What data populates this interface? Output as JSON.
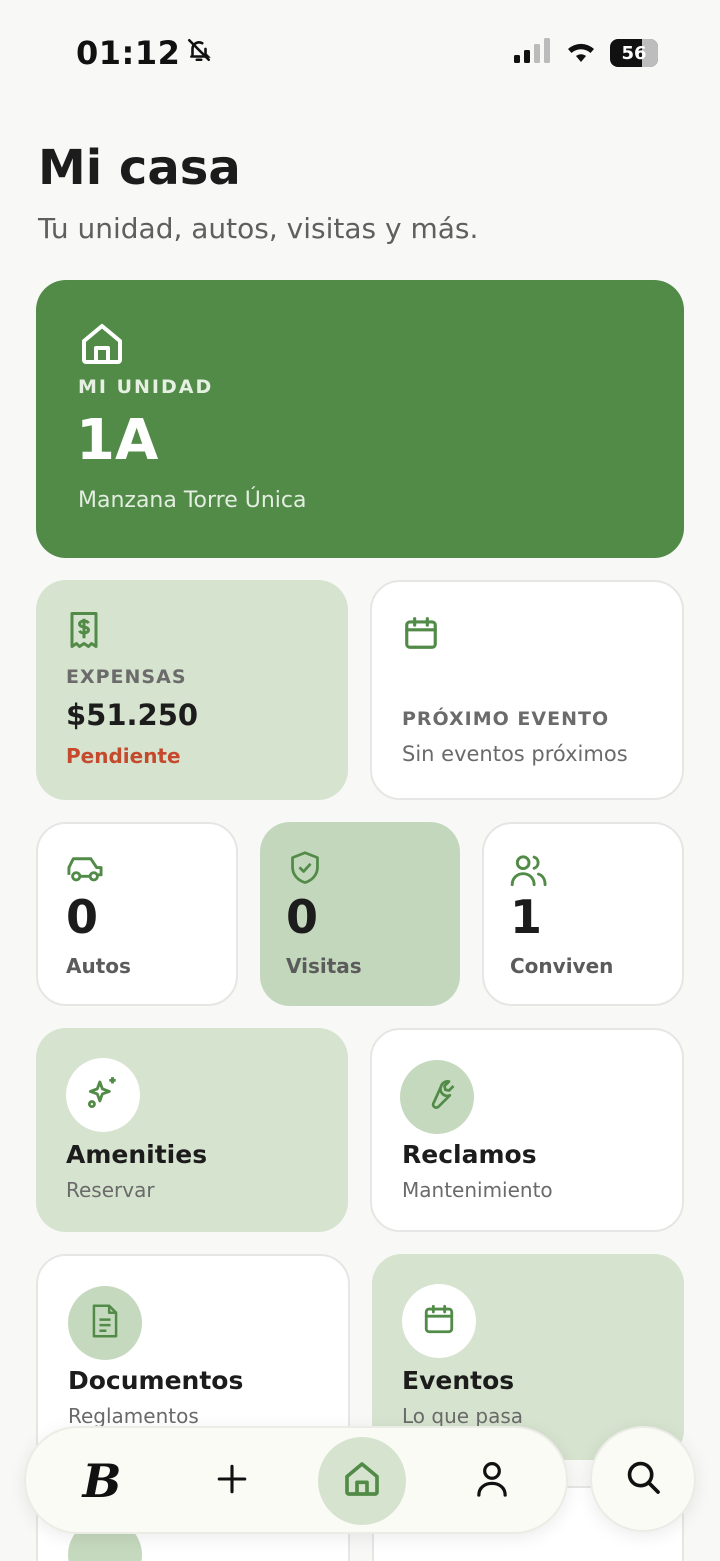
{
  "status_bar": {
    "time": "01:12",
    "battery": "56"
  },
  "header": {
    "title": "Mi casa",
    "subtitle": "Tu unidad, autos, visitas y más."
  },
  "unit": {
    "label": "MI UNIDAD",
    "value": "1A",
    "location": "Manzana Torre Única"
  },
  "expensas": {
    "label": "EXPENSAS",
    "amount": "$51.250",
    "status": "Pendiente"
  },
  "next_event": {
    "label": "PRÓXIMO EVENTO",
    "value": "Sin eventos próximos"
  },
  "stats": [
    {
      "value": "0",
      "label": "Autos"
    },
    {
      "value": "0",
      "label": "Visitas"
    },
    {
      "value": "1",
      "label": "Conviven"
    }
  ],
  "tiles": [
    {
      "title": "Amenities",
      "subtitle": "Reservar"
    },
    {
      "title": "Reclamos",
      "subtitle": "Mantenimiento"
    },
    {
      "title": "Documentos",
      "subtitle": "Reglamentos"
    },
    {
      "title": "Eventos",
      "subtitle": "Lo que pasa"
    }
  ],
  "nav": {
    "logo": "B"
  },
  "colors": {
    "primary_green": "#528b48",
    "light_green": "#d6e3cf",
    "pending_red": "#c4492d"
  }
}
